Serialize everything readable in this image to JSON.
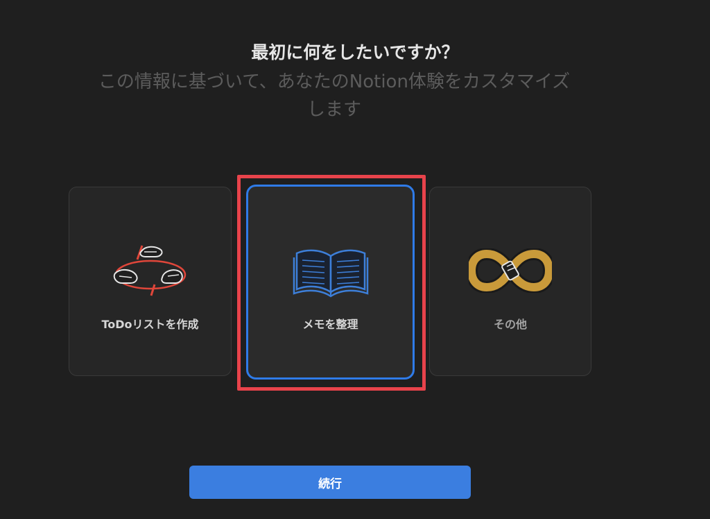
{
  "header": {
    "title": "最初に何をしたいですか？",
    "subtitle": "この情報に基づいて、あなたのNotion体験をカスタマイズします"
  },
  "options": [
    {
      "label": "ToDoリストを作成",
      "icon": "juggling-hands-icon",
      "selected": false
    },
    {
      "label": "メモを整理",
      "icon": "open-book-icon",
      "selected": true
    },
    {
      "label": "その他",
      "icon": "infinity-icon",
      "selected": false
    }
  ],
  "footer": {
    "continue_label": "続行"
  },
  "colors": {
    "background": "#1f1f1f",
    "card": "#262626",
    "selected_border": "#2f7be8",
    "annotation_red": "#e8434b",
    "button": "#3b7ee0",
    "book_blue": "#3d7fd9",
    "infinity_gold": "#c99a3a"
  }
}
